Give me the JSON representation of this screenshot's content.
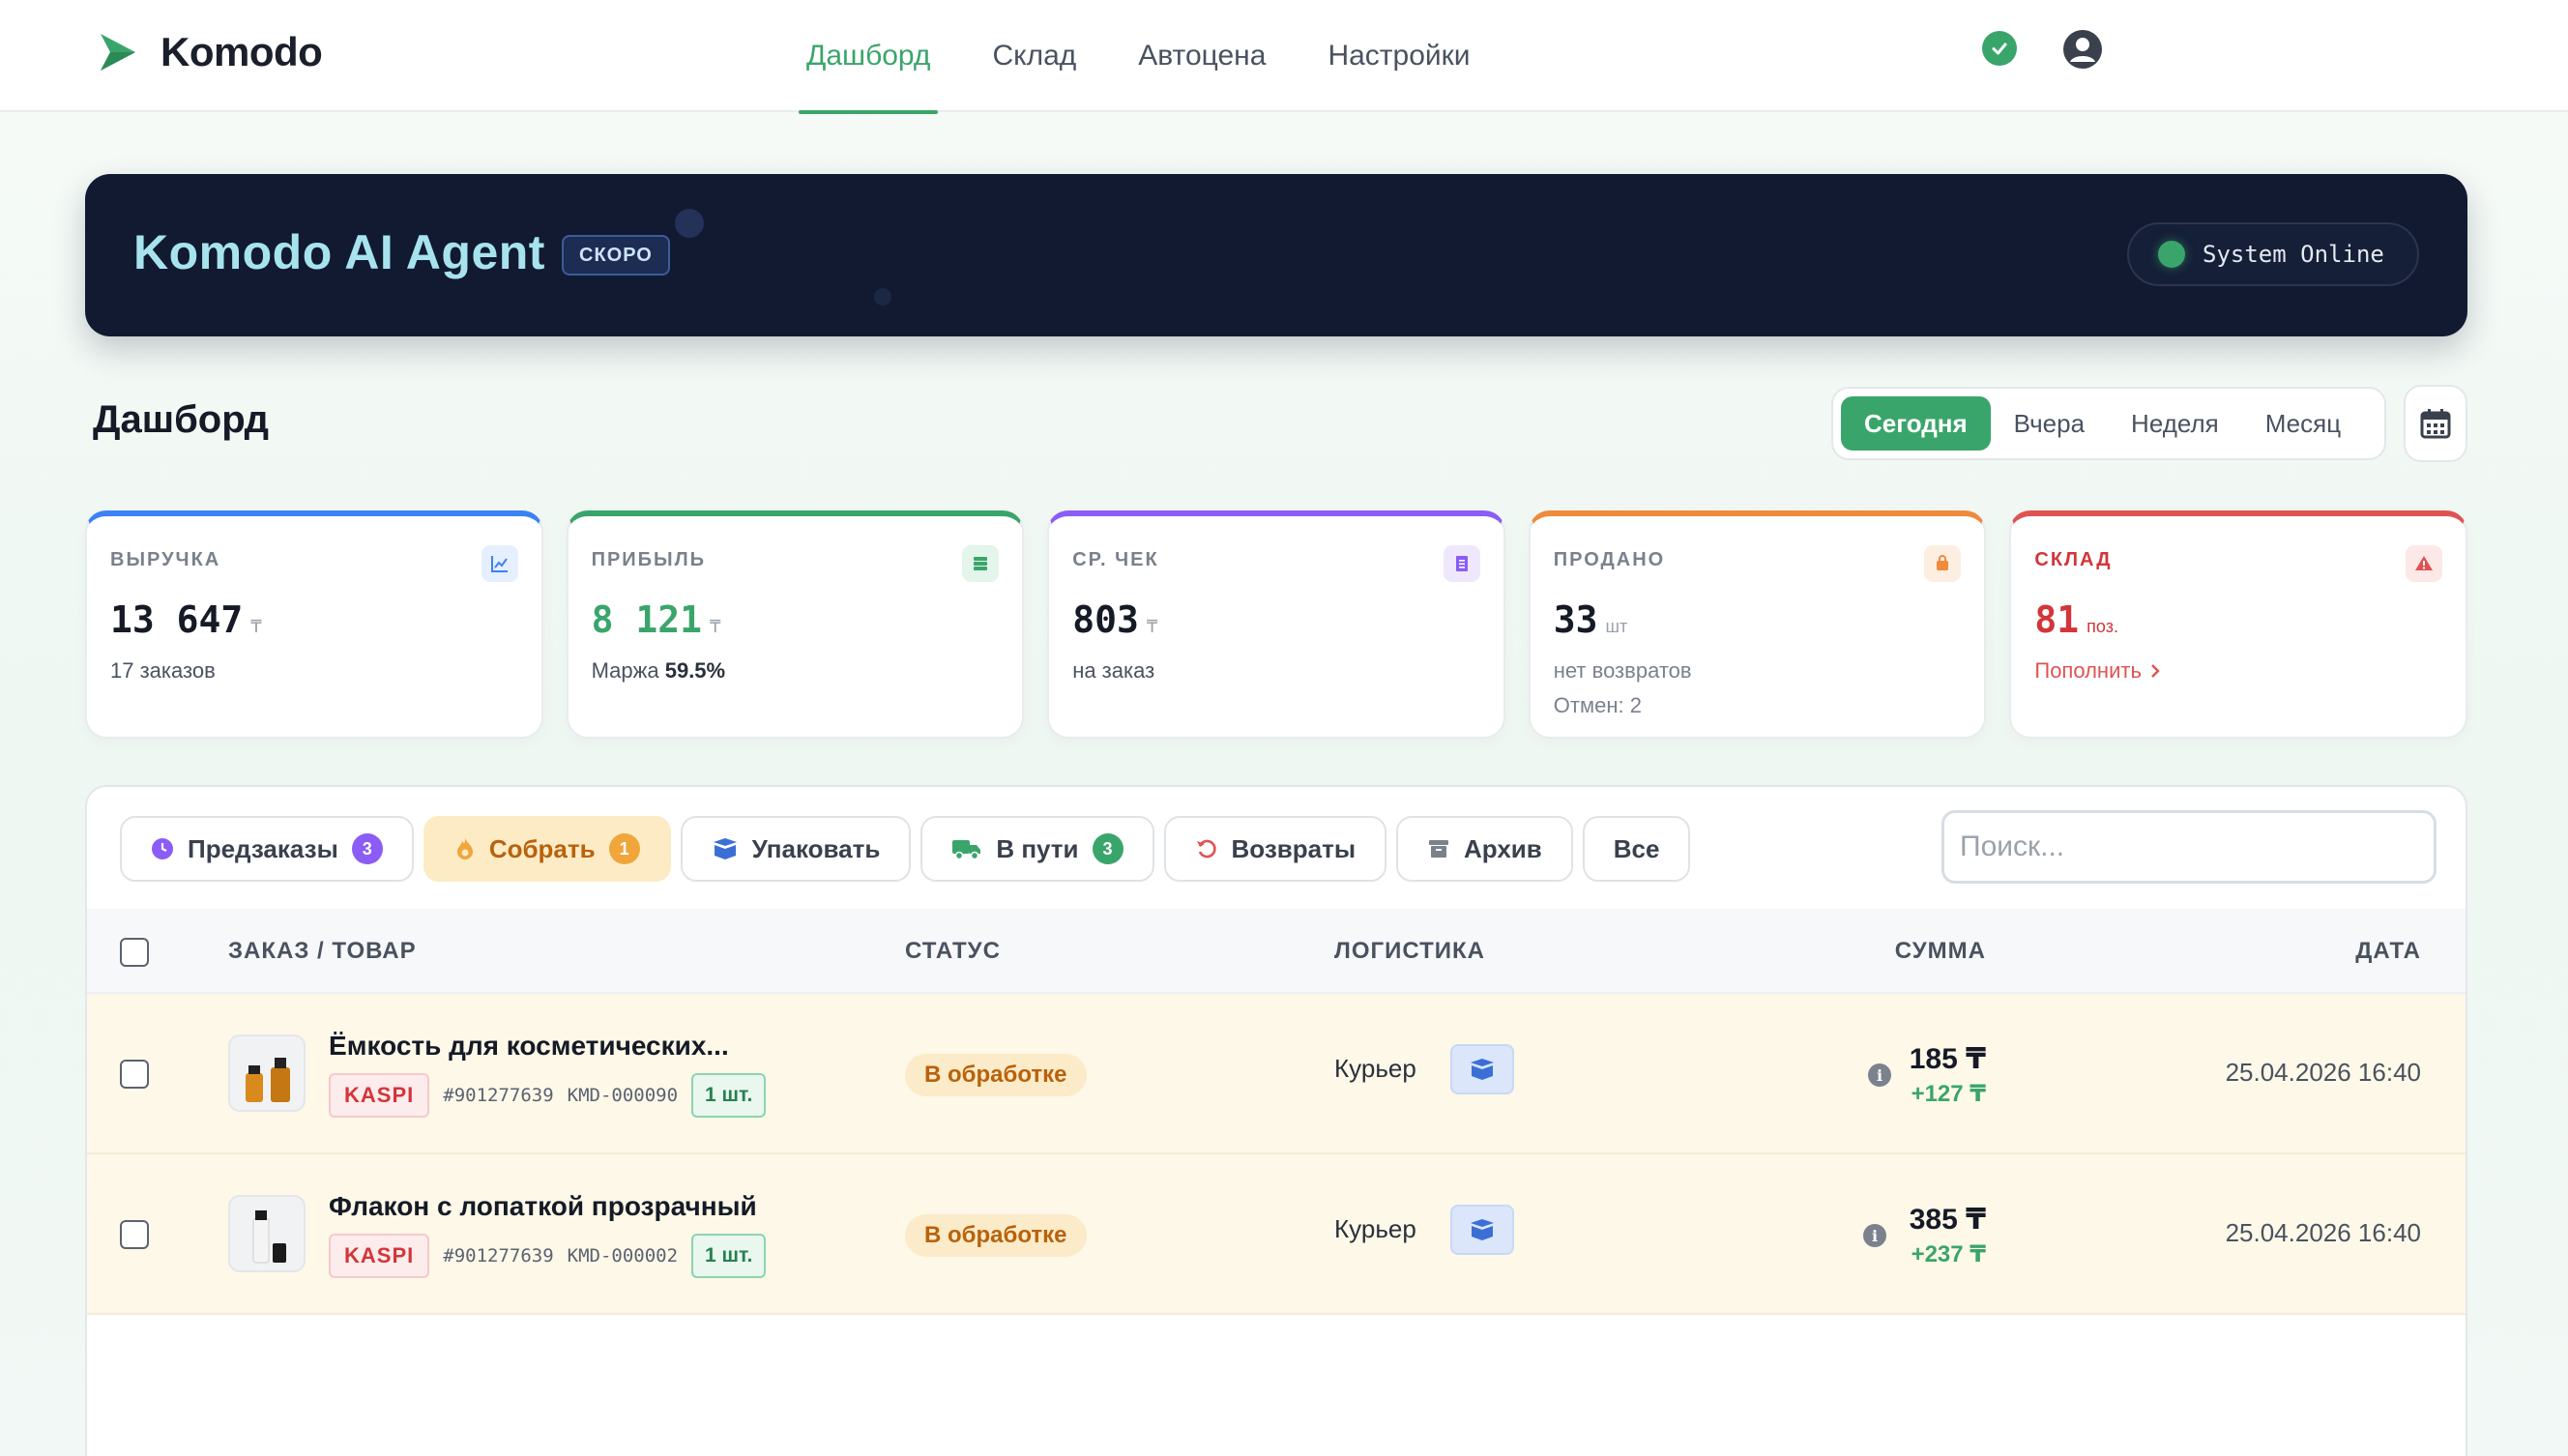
{
  "brand": {
    "name": "Komodo"
  },
  "nav": {
    "items": [
      {
        "label": "Дашборд",
        "active": true
      },
      {
        "label": "Склад",
        "active": false
      },
      {
        "label": "Автоцена",
        "active": false
      },
      {
        "label": "Настройки",
        "active": false
      }
    ]
  },
  "header_icons": {
    "status": "check-circle-icon",
    "user": "user-circle-icon"
  },
  "banner": {
    "title": "Komodo AI Agent",
    "badge": "СКОРО",
    "status": "System Online"
  },
  "dashboard": {
    "title": "Дашборд",
    "periods": [
      "Сегодня",
      "Вчера",
      "Неделя",
      "Месяц"
    ],
    "active_period": "Сегодня"
  },
  "kpis": [
    {
      "label": "ВЫРУЧКА",
      "value": "13 647",
      "unit": "₸",
      "sub": "17 заказов",
      "color": "#3b82f6",
      "icon": "chart-line-icon"
    },
    {
      "label": "ПРИБЫЛЬ",
      "value": "8 121",
      "unit": "₸",
      "sub_prefix": "Маржа",
      "sub_value": "59.5%",
      "color": "#3aa56b",
      "icon": "money-icon"
    },
    {
      "label": "СР. ЧЕК",
      "value": "803",
      "unit": "₸",
      "sub": "на заказ",
      "color": "#8b5cf6",
      "icon": "receipt-icon"
    },
    {
      "label": "ПРОДАНО",
      "value": "33",
      "unit": "шт",
      "sub": "нет возвратов",
      "sub2": "Отмен: 2",
      "color": "#f08a3c",
      "icon": "bag-icon"
    },
    {
      "label": "СКЛАД",
      "value": "81",
      "unit": "поз.",
      "link": "Пополнить",
      "color": "#e05252",
      "icon": "warning-icon"
    }
  ],
  "tabs": [
    {
      "label": "Предзаказы",
      "count": "3",
      "count_color": "#8b5cf6",
      "icon": "clock-icon",
      "active": false
    },
    {
      "label": "Собрать",
      "count": "1",
      "count_color": "#f0a63a",
      "icon": "fire-icon",
      "active": true
    },
    {
      "label": "Упаковать",
      "count": "",
      "icon": "box-icon",
      "active": false
    },
    {
      "label": "В пути",
      "count": "3",
      "count_color": "#3aa56b",
      "icon": "truck-icon",
      "active": false
    },
    {
      "label": "Возвраты",
      "count": "",
      "icon": "undo-icon",
      "active": false
    },
    {
      "label": "Архив",
      "count": "",
      "icon": "archive-icon",
      "active": false
    },
    {
      "label": "Все",
      "count": "",
      "icon": "",
      "active": false
    }
  ],
  "search": {
    "placeholder": "Поиск...",
    "value": ""
  },
  "table": {
    "columns": [
      "ЗАКАЗ / ТОВАР",
      "СТАТУС",
      "ЛОГИСТИКА",
      "СУММА",
      "ДАТА"
    ],
    "rows": [
      {
        "name": "Ёмкость для косметических...",
        "marketplace": "KASPI",
        "order_id": "#901277639",
        "sku": "KMD-000090",
        "qty": "1 шт.",
        "status": "В обработке",
        "logistics": "Курьер",
        "sum": "185 ₸",
        "profit": "+127 ₸",
        "date": "25.04.2026 16:40"
      },
      {
        "name": "Флакон с лопаткой прозрачный",
        "marketplace": "KASPI",
        "order_id": "#901277639",
        "sku": "KMD-000002",
        "qty": "1 шт.",
        "status": "В обработке",
        "logistics": "Курьер",
        "sum": "385 ₸",
        "profit": "+237 ₸",
        "date": "25.04.2026 16:40"
      }
    ]
  }
}
